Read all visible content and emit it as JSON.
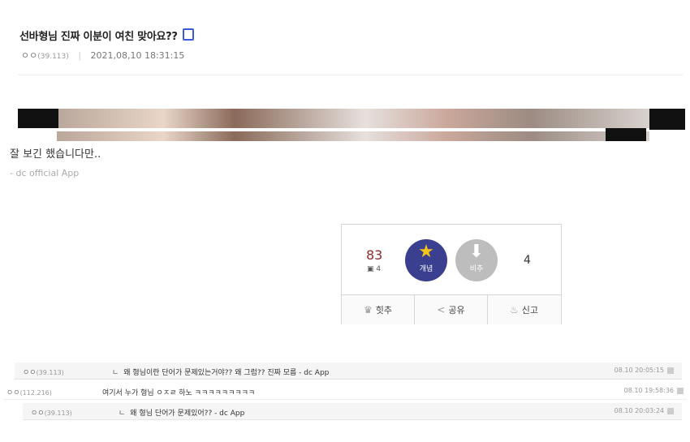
{
  "post": {
    "title": "선바형님 진짜 이분이 여친 맞아요??",
    "author": "ㅇㅇ",
    "author_ip": "(39.113)",
    "separator": "|",
    "datetime": "2021,08,10 18:31:15"
  },
  "content": {
    "text": "잘 보긴 했습니다만..",
    "signature": "- dc official App"
  },
  "recommend": {
    "up_count": "83",
    "fixed_count": "4",
    "up_label": "개념",
    "down_label": "비추",
    "down_count": "4",
    "up_icon": "star-icon",
    "down_icon": "arrow-down-icon",
    "buttons": [
      {
        "label": "힛추",
        "icon": "crown-icon"
      },
      {
        "label": "공유",
        "icon": "share-icon"
      },
      {
        "label": "신고",
        "icon": "siren-icon"
      }
    ]
  },
  "comments": [
    {
      "nick": "ㅇㅇ",
      "ip": "(39.113)",
      "arrow": "ㄴ",
      "text": "왜 형님이란 단어가 문제있는거야?? 왜 그럼?? 진짜 모름 - dc App",
      "date": "08.10 20:05:15"
    },
    {
      "nick": "ㅇㅇ",
      "ip": "(112.216)",
      "arrow": "",
      "text": "여기서 누가 형님 ㅇㅈㄹ 하노 ㅋㅋㅋㅋㅋㅋㅋㅋㅋ",
      "date": "08.10 19:58:36"
    },
    {
      "nick": "ㅇㅇ",
      "ip": "(39.113)",
      "arrow": "ㄴ",
      "text": "왜 형님 단어가 문제있어?? - dc App",
      "date": "08.10 20:03:24"
    }
  ],
  "colors": {
    "title_icon": "#3b5bdb",
    "up_circle": "#3a3f8f",
    "star": "#f5c518",
    "down_circle": "#bdbdbd",
    "up_count": "#8b2c2c"
  }
}
